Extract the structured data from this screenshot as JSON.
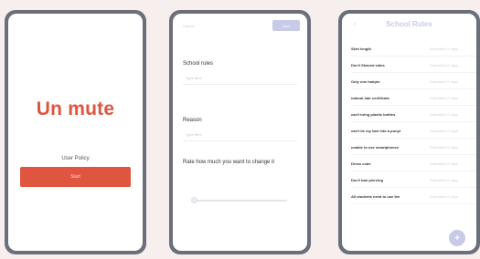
{
  "screen1": {
    "brand": "Un mute",
    "policy_link": "User Policy",
    "start_button": "Start"
  },
  "screen2": {
    "top_label": "Cancel",
    "next_button": "Next",
    "rules_label": "School rules",
    "rules_placeholder": "Type here",
    "reason_label": "Reason",
    "reason_placeholder": "Type here",
    "rating_label": "Rate how much you want to change it",
    "rating_value": 0
  },
  "screen3": {
    "back": "‹",
    "title": "School Rules",
    "rules": [
      {
        "name": "Skirt length",
        "meta": "Submitted 2 days"
      },
      {
        "name": "Don't Shaved sides",
        "meta": "Submitted 2 days"
      },
      {
        "name": "Only one hairpin",
        "meta": "Submitted 2 days"
      },
      {
        "name": "natural hair certificate",
        "meta": "Submitted 2 days"
      },
      {
        "name": "can't bring plastic bottles",
        "meta": "Submitted 2 days"
      },
      {
        "name": "can't tie my hair into a ponyt",
        "meta": "Submitted 2 days"
      },
      {
        "name": "unable to use smartphones",
        "meta": "Submitted 2 days"
      },
      {
        "name": "Dress code",
        "meta": "Submitted 2 days"
      },
      {
        "name": "Don't ban piercing",
        "meta": "Submitted 2 days"
      },
      {
        "name": "All students need to use the",
        "meta": "Submitted 2 days"
      }
    ],
    "fab_label": "+"
  },
  "colors": {
    "background": "#f7eeee",
    "accent": "#e0553f",
    "lavender": "#c7cbe8",
    "frame": "#6b6f7a"
  }
}
